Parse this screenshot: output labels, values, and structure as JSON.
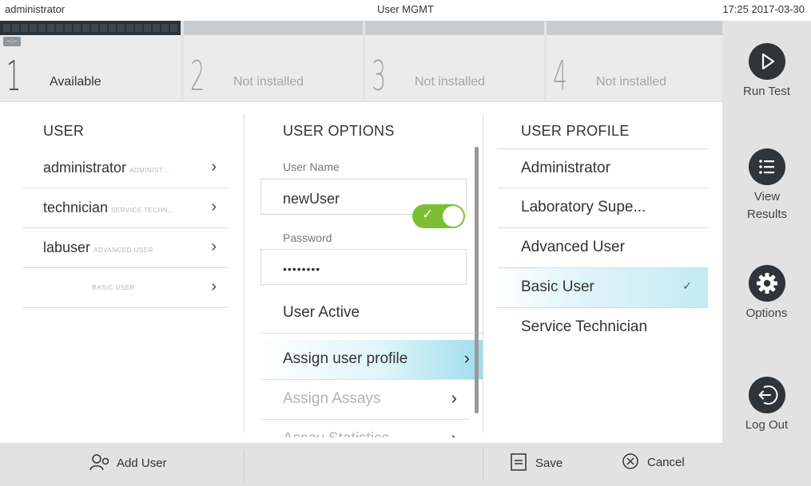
{
  "statusbar": {
    "user": "administrator",
    "title": "User MGMT",
    "datetime": "17:25 2017-03-30"
  },
  "modules": [
    {
      "number": "1",
      "status": "Available",
      "badge": "--:--"
    },
    {
      "number": "2",
      "status": "Not installed"
    },
    {
      "number": "3",
      "status": "Not installed"
    },
    {
      "number": "4",
      "status": "Not installed"
    }
  ],
  "sidebar": {
    "run_test": "Run Test",
    "view_results": "View Results",
    "options": "Options",
    "log_out": "Log Out"
  },
  "user_column": {
    "title": "USER",
    "users": [
      {
        "name": "administrator",
        "role": "ADMINIST..."
      },
      {
        "name": "technician",
        "role": "SERVICE TECHN..."
      },
      {
        "name": "labuser",
        "role": "ADVANCED USER"
      },
      {
        "name": "",
        "role": "BASIC USER"
      }
    ]
  },
  "options_column": {
    "title": "USER OPTIONS",
    "username_label": "User Name",
    "username_value": "newUser",
    "password_label": "Password",
    "password_value": "••••••••",
    "user_active_label": "User Active",
    "user_active": true,
    "items": [
      {
        "label": "Assign user profile",
        "state": "selected"
      },
      {
        "label": "Assign Assays",
        "state": "disabled"
      },
      {
        "label": "Assay Statistics",
        "state": "disabled"
      }
    ]
  },
  "profile_column": {
    "title": "USER PROFILE",
    "profiles": [
      {
        "label": "Administrator"
      },
      {
        "label": "Laboratory Supe..."
      },
      {
        "label": "Advanced User"
      },
      {
        "label": "Basic User",
        "selected": true
      },
      {
        "label": "Service Technician"
      }
    ]
  },
  "bottombar": {
    "add_user": "Add User",
    "save": "Save",
    "cancel": "Cancel"
  },
  "colors": {
    "accent_selected": "#9fdeee",
    "toggle_on": "#7cbf35",
    "dark_button": "#2e3439"
  }
}
